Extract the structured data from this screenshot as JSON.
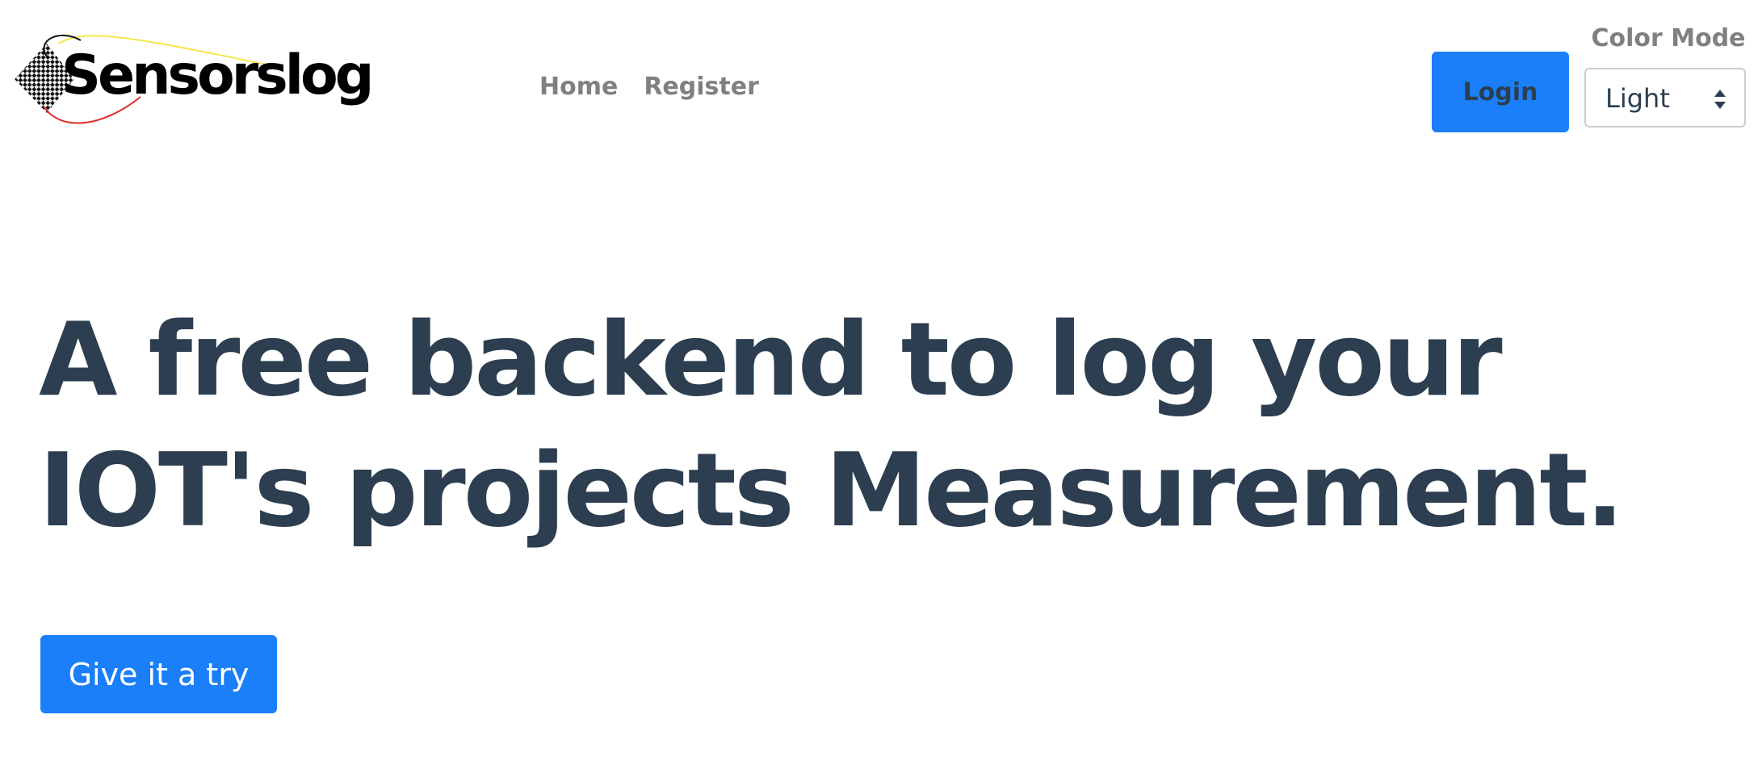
{
  "header": {
    "logo_text": "Sensorslog",
    "nav": [
      {
        "label": "Home"
      },
      {
        "label": "Register"
      }
    ],
    "login_label": "Login",
    "color_mode": {
      "label": "Color Mode",
      "selected": "Light"
    }
  },
  "hero": {
    "title_line1": "A free backend to log your",
    "title_line2": "IOT's projects Measurement.",
    "cta_label": "Give it a try"
  },
  "colors": {
    "primary": "#1a7ff8",
    "heading": "#2c3e50",
    "nav_text": "#808080"
  },
  "icons": {
    "logo_mark": "checkered-diamond-icon",
    "select_arrows": "chevron-up-down-icon"
  }
}
